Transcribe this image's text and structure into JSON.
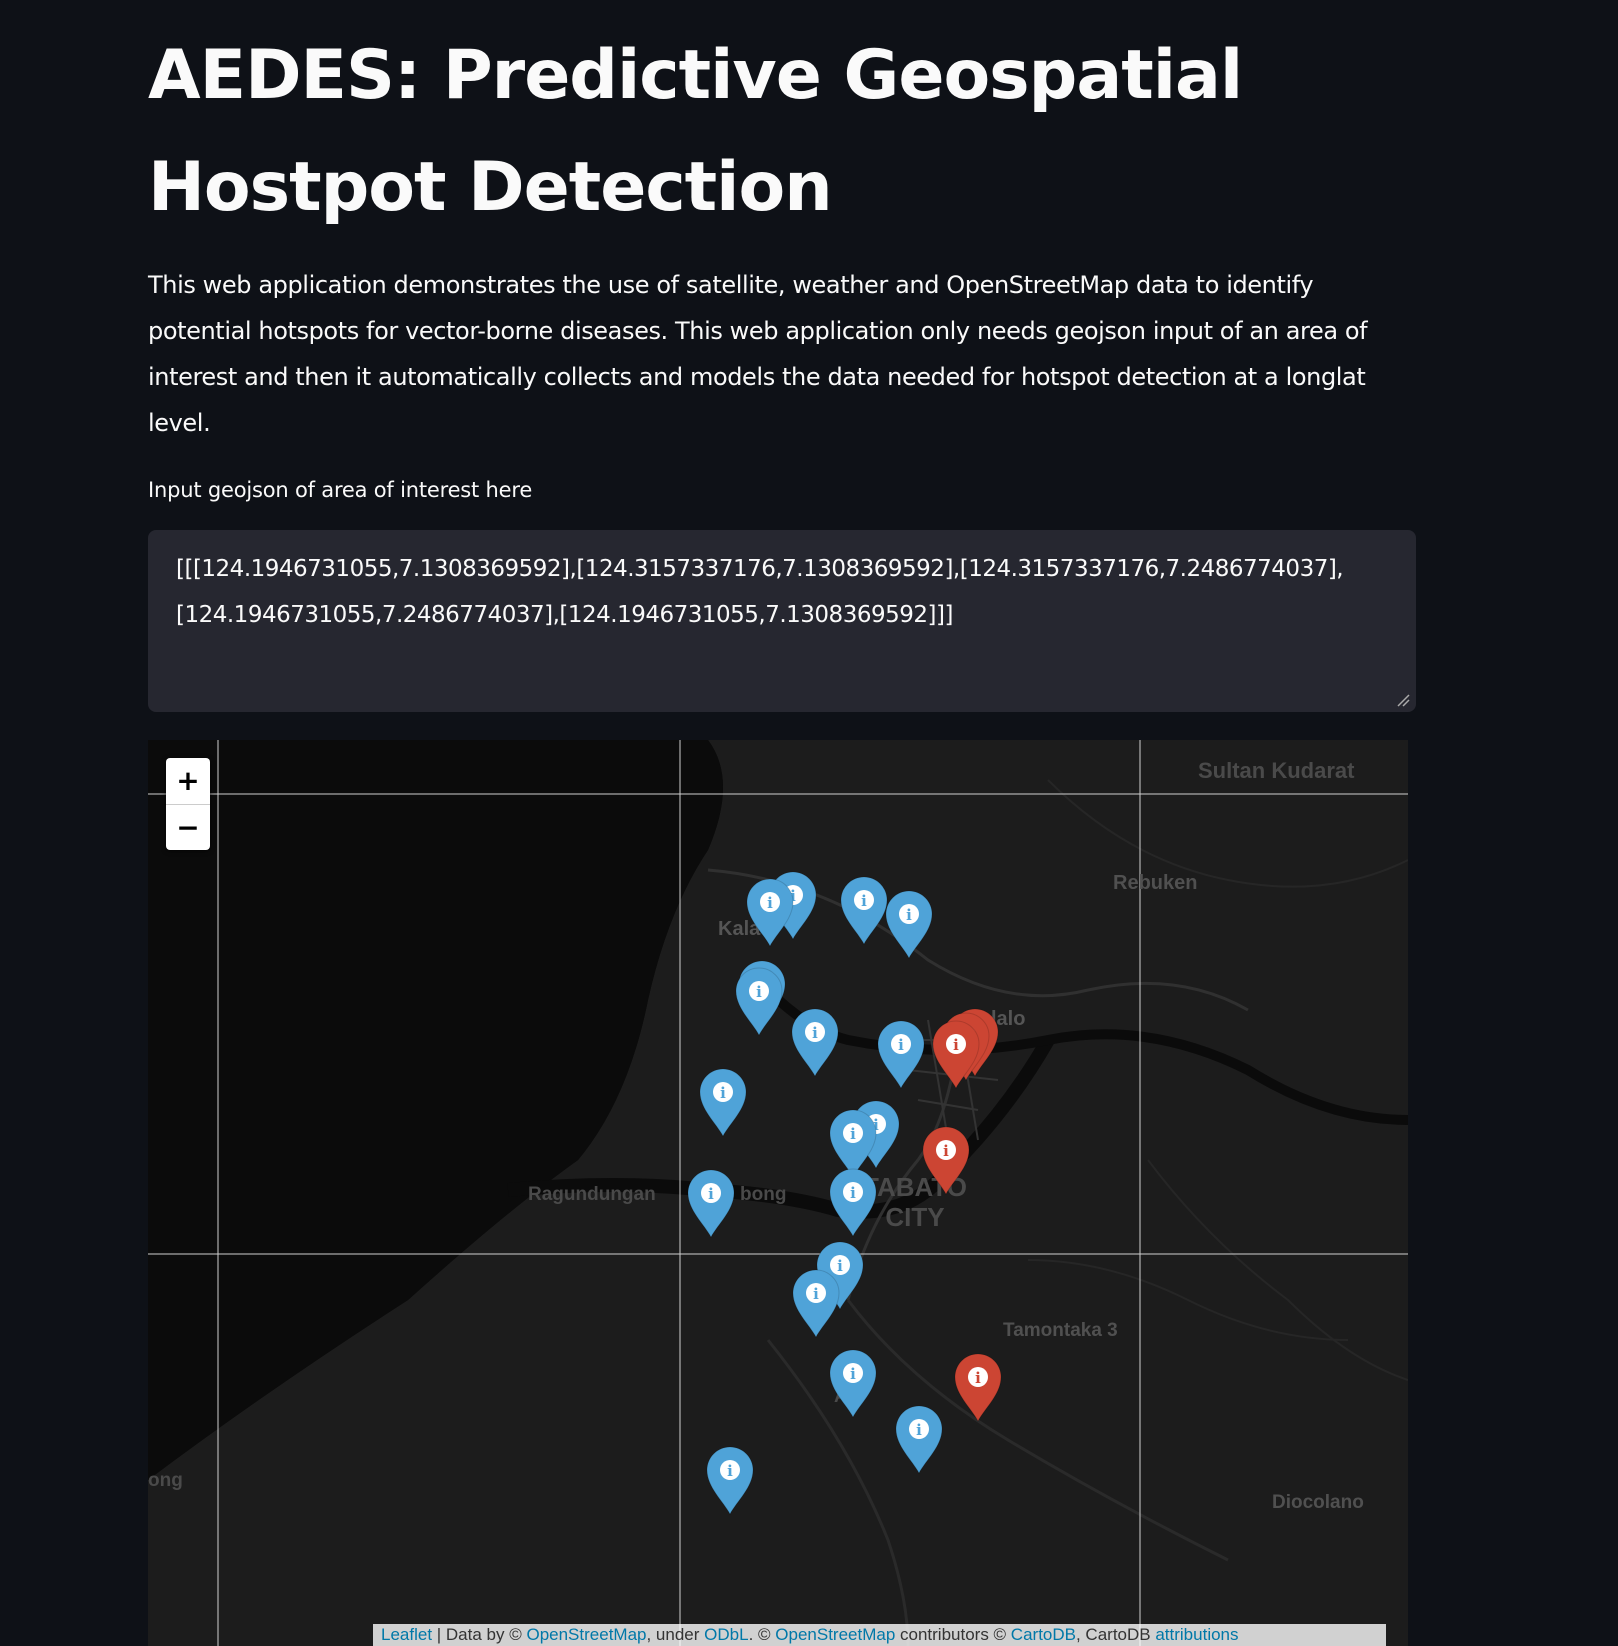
{
  "page": {
    "title": "AEDES: Predictive Geospatial Hostpot Detection",
    "description": "This web application demonstrates the use of satellite, weather and OpenStreetMap data to identify potential hotspots for vector-borne diseases. This web application only needs geojson input of an area of interest and then it automatically collects and models the data needed for hotspot detection at a longlat level."
  },
  "input": {
    "label": "Input geojson of area of interest here",
    "value": "[[[124.1946731055,7.1308369592],[124.3157337176,7.1308369592],[124.3157337176,7.2486774037],[124.1946731055,7.2486774037],[124.1946731055,7.1308369592]]]"
  },
  "map": {
    "zoom_in": "+",
    "zoom_out": "−",
    "places": {
      "sultan_kudarat": "Sultan Kudarat",
      "rebuken": "Rebuken",
      "kalanganan": "Kala n",
      "ilalo": "lalo",
      "ragundungan": "Ragundungan",
      "bong": "bong",
      "cotabato_city": "TABATO\nCITY",
      "tamontaka": "Tamontaka 3",
      "diocolano": "Diocolano",
      "ong": "ong",
      "awang": "A"
    },
    "marker_colors": {
      "normal": "#4fa3d8",
      "hotspot": "#cc4533"
    },
    "marker_icon": "info-icon"
  },
  "attribution": {
    "leaflet": "Leaflet",
    "sep1": " | Data by © ",
    "osm": "OpenStreetMap",
    "under": ", under ",
    "odbl": "ODbL",
    "sep2": ". © ",
    "osm2": "OpenStreetMap",
    "contrib": " contributors © ",
    "cartodb": "CartoDB",
    "cartodb_text": ", CartoDB ",
    "attributions": "attributions"
  }
}
